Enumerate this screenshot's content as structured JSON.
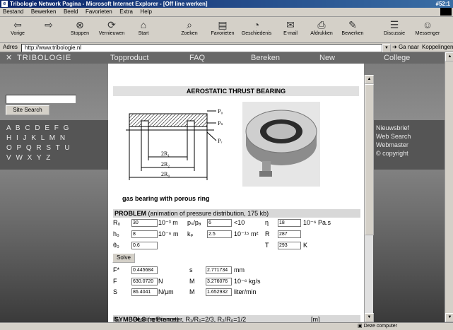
{
  "window": {
    "title": "Tribologie Network Pagina - Microsoft Internet Explorer - [Off line werken]",
    "corner": "#52:1"
  },
  "menu": [
    "Bestand",
    "Bewerken",
    "Beeld",
    "Favorieten",
    "Extra",
    "Help"
  ],
  "toolbar": [
    {
      "label": "Vorige",
      "icon": "back-arrow"
    },
    {
      "label": "",
      "icon": "forward-arrow"
    },
    {
      "label": "Stoppen",
      "icon": "stop"
    },
    {
      "label": "Vernieuwen",
      "icon": "refresh"
    },
    {
      "label": "Start",
      "icon": "home"
    },
    {
      "label": "Zoeken",
      "icon": "search"
    },
    {
      "label": "Favorieten",
      "icon": "favorites"
    },
    {
      "label": "Geschiedenis",
      "icon": "history"
    },
    {
      "label": "E-mail",
      "icon": "mail"
    },
    {
      "label": "Afdrukken",
      "icon": "print"
    },
    {
      "label": "Bewerken",
      "icon": "edit"
    },
    {
      "label": "Discussie",
      "icon": "discussion"
    },
    {
      "label": "Messenger",
      "icon": "messenger"
    }
  ],
  "address": {
    "label": "Adres",
    "url": "http://www.tribologie.nl",
    "go": "Ga naar",
    "links": "Koppelingen"
  },
  "nav": {
    "brand": "TRIBOLOGIE",
    "items": [
      "Topproduct",
      "FAQ",
      "Bereken",
      "New",
      "College"
    ]
  },
  "sidebar": {
    "search_button": "Site Search",
    "alphabet": [
      "A B C D E F G",
      "H I J K L M N",
      "O P Q R S T U",
      "V W X Y Z"
    ]
  },
  "rightbox": {
    "items": [
      "Nieuwsbrief",
      "Web Search",
      "Webmaster",
      "© copyright"
    ]
  },
  "content": {
    "title": "AEROSTATIC THRUST BEARING",
    "diagram_labels": {
      "p0": "P₀",
      "ps": "Pₛ",
      "pr": "Pᵣ",
      "r1": "2R₁",
      "r2": "2R₂",
      "r0": "2R₀"
    },
    "caption": "gas bearing with porous ring",
    "problem": {
      "heading": "PROBLEM",
      "link": "(animation of pressure distribution, 175 kb)"
    },
    "inputs": [
      {
        "label": "R₀",
        "value": "30",
        "unit": "10⁻³ m"
      },
      {
        "label": "h₀",
        "value": "8",
        "unit": "10⁻⁶ m"
      },
      {
        "label": "θ₀",
        "value": "0.6",
        "unit": ""
      },
      {
        "label": "pₛ/pₐ",
        "value": "6",
        "unit": "<10"
      },
      {
        "label": "kₚ",
        "value": "2.5",
        "unit": "10⁻¹⁵ m²"
      },
      {
        "label": "η",
        "value": "18",
        "unit": "10⁻⁶ Pa.s"
      },
      {
        "label": "R",
        "value": "287",
        "unit": ""
      },
      {
        "label": "T",
        "value": "293",
        "unit": "K"
      }
    ],
    "solve": "Solve",
    "results": [
      {
        "label": "F*",
        "value": "0.445684",
        "unit": ""
      },
      {
        "label": "F",
        "value": "630.0720",
        "unit": "N"
      },
      {
        "label": "S",
        "value": "86.4041",
        "unit": "N/µm"
      },
      {
        "label": "s",
        "value": "2.771734",
        "unit": "mm"
      },
      {
        "label": "M",
        "value": "3.276076",
        "unit": "10⁻⁶ kg/s"
      },
      {
        "label": "M",
        "value": "1.652932",
        "unit": "liter/min"
      }
    ],
    "symbols": {
      "heading": "SYMBOLS",
      "link": "(reference)",
      "row_label": "R₀",
      "row_text": "Bearing Diameter, R₁/R₀=2/3, R₂/R₀=1/2",
      "row_unit": "[m]"
    }
  },
  "status": {
    "text": "",
    "zone": "Deze computer"
  }
}
